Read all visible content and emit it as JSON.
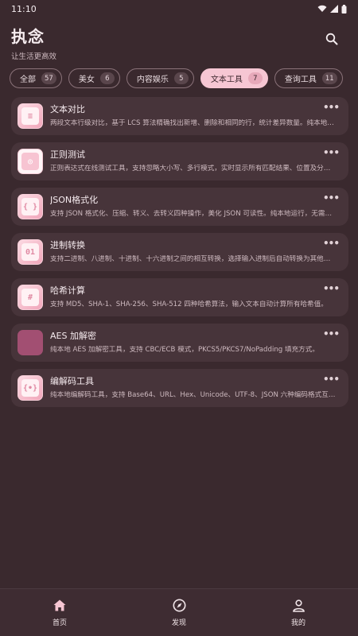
{
  "status": {
    "time": "11:10"
  },
  "header": {
    "title": "执念",
    "subtitle": "让生活更高效"
  },
  "chips": [
    {
      "label": "全部",
      "count": "57"
    },
    {
      "label": "美女",
      "count": "6"
    },
    {
      "label": "内容娱乐",
      "count": "5"
    },
    {
      "label": "文本工具",
      "count": "7"
    },
    {
      "label": "查询工具",
      "count": "11"
    }
  ],
  "tools": [
    {
      "title": "文本对比",
      "desc": "两段文本行级对比，基于 LCS 算法精确找出新增、删除和相同的行，统计差异数量。纯本地运行。",
      "icon": "compare-icon"
    },
    {
      "title": "正则测试",
      "desc": "正则表达式在线测试工具，支持忽略大小写、多行模式，实时显示所有匹配结果、位置及分组。",
      "icon": "regex-icon"
    },
    {
      "title": "JSON格式化",
      "desc": "支持 JSON 格式化、压缩、转义、去转义四种操作，美化 JSON 可读性。纯本地运行，无需联网。",
      "icon": "braces-icon"
    },
    {
      "title": "进制转换",
      "desc": "支持二进制、八进制、十进制、十六进制之间的相互转换，选择输入进制后自动转换为其他进制。",
      "icon": "binary-icon"
    },
    {
      "title": "哈希计算",
      "desc": "支持 MD5、SHA-1、SHA-256、SHA-512 四种哈希算法，输入文本自动计算所有哈希值。",
      "icon": "hash-icon"
    },
    {
      "title": "AES 加解密",
      "desc": "纯本地 AES 加解密工具，支持 CBC/ECB 模式，PKCS5/PKCS7/NoPadding 填充方式。",
      "icon": "lock-icon"
    },
    {
      "title": "编解码工具",
      "desc": "纯本地编解码工具，支持 Base64、URL、Hex、Unicode、UTF-8、JSON 六种编码格式互转。",
      "icon": "code-icon"
    }
  ],
  "nav": [
    {
      "label": "首页"
    },
    {
      "label": "发现"
    },
    {
      "label": "我的"
    }
  ],
  "colors": {
    "background": "#3a292e",
    "card": "#47343a",
    "accent": "#f6c6d3",
    "aes_thumb": "#a24f72"
  }
}
